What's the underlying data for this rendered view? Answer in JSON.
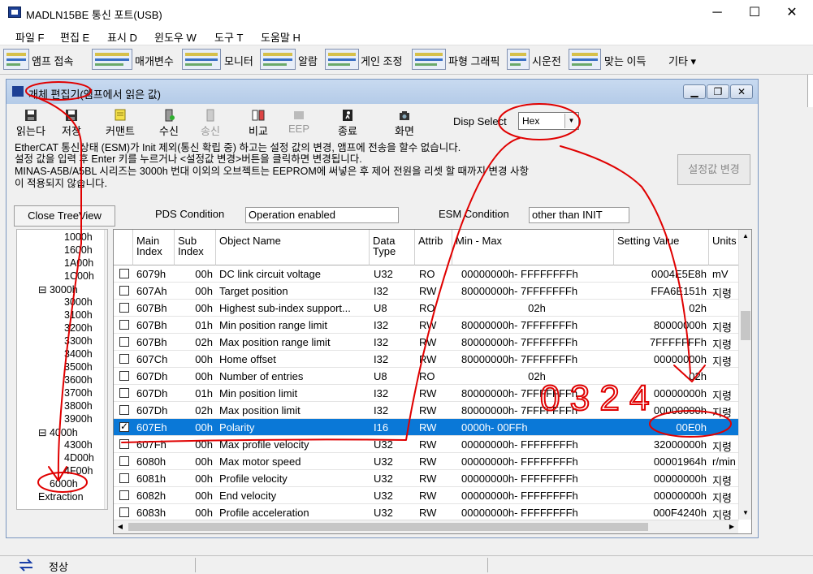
{
  "window": {
    "title": "MADLN15BE  통신 포트(USB)",
    "minimize": "─",
    "maximize": "☐",
    "close": "✕"
  },
  "menu": [
    "파일 F",
    "편집 E",
    "표시 D",
    "윈도우 W",
    "도구 T",
    "도움말 H"
  ],
  "toolbar": [
    "앰프 접속",
    "매개변수",
    "모니터",
    "알람",
    "게인 조정",
    "파형 그래픽",
    "시운전",
    "맞는 이득",
    "기타 ▾"
  ],
  "child": {
    "title": "개체 편집기(앰프에서 읽은 값)",
    "tools": [
      "읽는다",
      "저장",
      "커맨트",
      "수신",
      "송신",
      "비교",
      "EEP",
      "종료",
      "화면"
    ],
    "disp_select_label": "Disp Select",
    "disp_select_value": "Hex",
    "info_lines": [
      "EtherCAT 통신상태 (ESM)가 Init 제외(통신 확립 중) 하고는 설정 값의 변경, 앰프에 전송을 할수 없습니다.",
      "설정 값을 입력 후 Enter 키를 누르거나 <설정값 변경>버튼을 클릭하면 변경됩니다.",
      "MINAS-A5B/A5BL 시리즈는 3000h 번대 이외의 오브젝트는 EEPROM에 써넣은 후 제어 전원을 리셋 할 때까지 변경 사항",
      "이 적용되지 않습니다."
    ],
    "apply_button": "설정값 변경",
    "close_tree": "Close TreeView",
    "pds_label": "PDS Condition",
    "pds_value": "Operation enabled",
    "esm_label": "ESM Condition",
    "esm_value": "other than INIT"
  },
  "tree": [
    "1000h",
    "1600h",
    "1A00h",
    "1C00h",
    "3000h",
    "3000h",
    "3100h",
    "3200h",
    "3300h",
    "3400h",
    "3500h",
    "3600h",
    "3700h",
    "3800h",
    "3900h",
    "4000h",
    "4300h",
    "4D00h",
    "4F00h",
    "6000h",
    "Extraction"
  ],
  "grid": {
    "headers": [
      "Main Index",
      "Sub Index",
      "Object Name",
      "Data Type",
      "Attrib",
      "Min - Max",
      "Setting Value",
      "Units"
    ],
    "rows": [
      {
        "checked": false,
        "main": "6079h",
        "sub": "00h",
        "name": "DC link circuit voltage",
        "type": "U32",
        "attrib": "RO",
        "minmax": "00000000h-  FFFFFFFFh",
        "value": "0004E5E8h",
        "units": "mV",
        "selected": false
      },
      {
        "checked": false,
        "main": "607Ah",
        "sub": "00h",
        "name": "Target position",
        "type": "I32",
        "attrib": "RW",
        "minmax": "80000000h-  7FFFFFFFh",
        "value": "FFA6E151h",
        "units": "지령",
        "selected": false
      },
      {
        "checked": false,
        "main": "607Bh",
        "sub": "00h",
        "name": "Highest sub-index support...",
        "type": "U8",
        "attrib": "RO",
        "minmax": "02h",
        "value": "02h",
        "units": "",
        "selected": false
      },
      {
        "checked": false,
        "main": "607Bh",
        "sub": "01h",
        "name": "Min position range limit",
        "type": "I32",
        "attrib": "RW",
        "minmax": "80000000h-  7FFFFFFFh",
        "value": "80000000h",
        "units": "지령",
        "selected": false
      },
      {
        "checked": false,
        "main": "607Bh",
        "sub": "02h",
        "name": "Max position range limit",
        "type": "I32",
        "attrib": "RW",
        "minmax": "80000000h-  7FFFFFFFh",
        "value": "7FFFFFFFh",
        "units": "지령",
        "selected": false
      },
      {
        "checked": false,
        "main": "607Ch",
        "sub": "00h",
        "name": "Home offset",
        "type": "I32",
        "attrib": "RW",
        "minmax": "80000000h-  7FFFFFFFh",
        "value": "00000000h",
        "units": "지령",
        "selected": false
      },
      {
        "checked": false,
        "main": "607Dh",
        "sub": "00h",
        "name": "Number of entries",
        "type": "U8",
        "attrib": "RO",
        "minmax": "02h",
        "value": "02h",
        "units": "",
        "selected": false
      },
      {
        "checked": false,
        "main": "607Dh",
        "sub": "01h",
        "name": "Min position limit",
        "type": "I32",
        "attrib": "RW",
        "minmax": "80000000h-  7FFFFFFFh",
        "value": "00000000h",
        "units": "지령",
        "selected": false
      },
      {
        "checked": false,
        "main": "607Dh",
        "sub": "02h",
        "name": "Max position limit",
        "type": "I32",
        "attrib": "RW",
        "minmax": "80000000h-  7FFFFFFFh",
        "value": "00000000h",
        "units": "지령",
        "selected": false
      },
      {
        "checked": true,
        "main": "607Eh",
        "sub": "00h",
        "name": "Polarity",
        "type": "I16",
        "attrib": "RW",
        "minmax": "0000h-      00FFh",
        "value": "00E0h",
        "units": "",
        "selected": true
      },
      {
        "checked": false,
        "main": "607Fh",
        "sub": "00h",
        "name": "Max profile velocity",
        "type": "U32",
        "attrib": "RW",
        "minmax": "00000000h-  FFFFFFFFh",
        "value": "32000000h",
        "units": "지령",
        "selected": false
      },
      {
        "checked": false,
        "main": "6080h",
        "sub": "00h",
        "name": "Max motor speed",
        "type": "U32",
        "attrib": "RW",
        "minmax": "00000000h-  FFFFFFFFh",
        "value": "00001964h",
        "units": "r/min",
        "selected": false
      },
      {
        "checked": false,
        "main": "6081h",
        "sub": "00h",
        "name": "Profile velocity",
        "type": "U32",
        "attrib": "RW",
        "minmax": "00000000h-  FFFFFFFFh",
        "value": "00000000h",
        "units": "지령",
        "selected": false
      },
      {
        "checked": false,
        "main": "6082h",
        "sub": "00h",
        "name": "End velocity",
        "type": "U32",
        "attrib": "RW",
        "minmax": "00000000h-  FFFFFFFFh",
        "value": "00000000h",
        "units": "지령",
        "selected": false
      },
      {
        "checked": false,
        "main": "6083h",
        "sub": "00h",
        "name": "Profile acceleration",
        "type": "U32",
        "attrib": "RW",
        "minmax": "00000000h-  FFFFFFFFh",
        "value": "000F4240h",
        "units": "지령",
        "selected": false
      }
    ]
  },
  "status": {
    "text": "정상"
  },
  "annotation_text": "0 3 2 4"
}
